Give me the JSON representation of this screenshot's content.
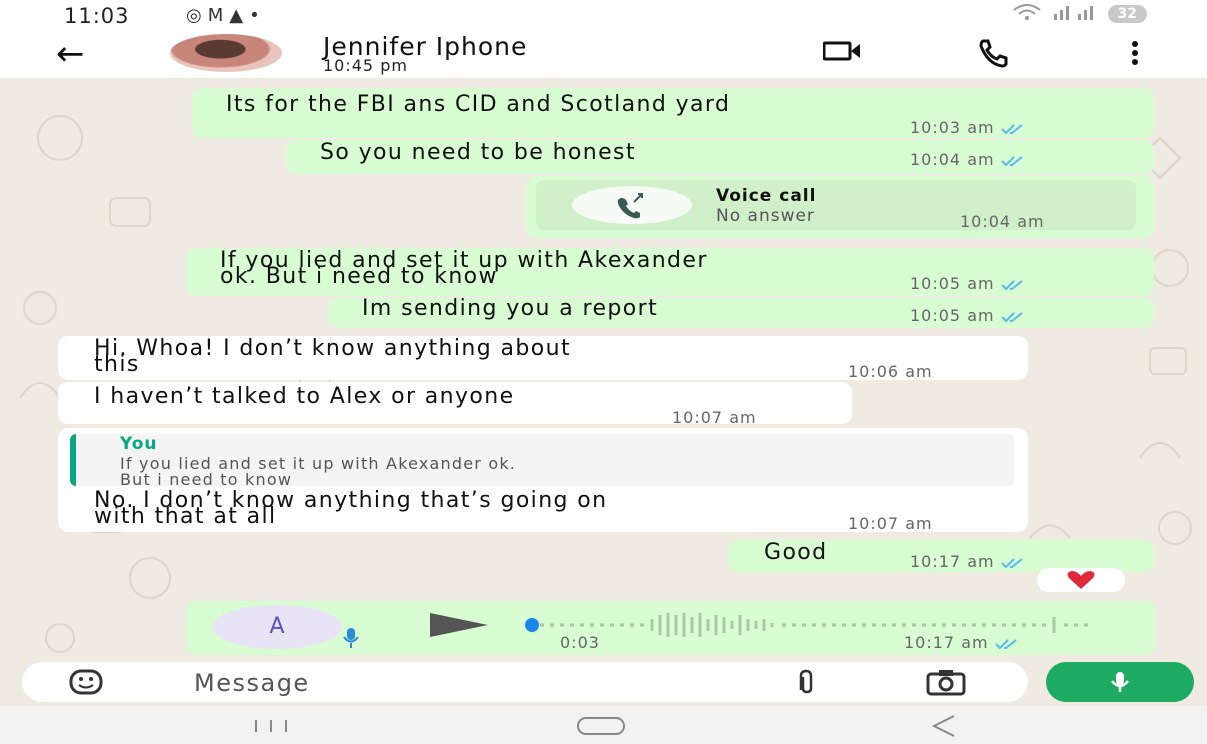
{
  "status_bar": {
    "time": "11:03",
    "left_icons": [
      "instagram-icon",
      "gmail-icon",
      "drive-icon"
    ],
    "battery": "32"
  },
  "header": {
    "contact_name": "Jennifer Iphone",
    "last_seen": "10:45 pm"
  },
  "messages": [
    {
      "dir": "out",
      "text": "Its for the FBI ans CID and Scotland yard",
      "time": "10:03 am",
      "read": true
    },
    {
      "dir": "out",
      "text": "So you need to be honest",
      "time": "10:04 am",
      "read": true
    },
    {
      "dir": "out",
      "type": "call",
      "title": "Voice call",
      "subtitle": "No answer",
      "time": "10:04 am"
    },
    {
      "dir": "out",
      "line1": "If you lied and set it up with Akexander",
      "line2": "ok. But i need to know",
      "time": "10:05 am",
      "read": true
    },
    {
      "dir": "out",
      "text": "Im sending you a report",
      "time": "10:05 am",
      "read": true
    },
    {
      "dir": "in",
      "line1": "Hi. Whoa! I don’t know anything about",
      "line2": "this",
      "time": "10:06 am"
    },
    {
      "dir": "in",
      "text": "I haven’t talked to Alex or anyone",
      "time": "10:07 am"
    },
    {
      "dir": "in",
      "quote_author": "You",
      "quote_line1": "If you lied and set it up with Akexander ok.",
      "quote_line2": "But i need to know",
      "line1": "No. I don’t know anything that’s going on",
      "line2": "with that at all",
      "time": "10:07 am"
    },
    {
      "dir": "out",
      "text": "Good",
      "time": "10:17 am",
      "read": true,
      "reaction": "red-heart"
    },
    {
      "dir": "out",
      "type": "voice",
      "avatar_letter": "A",
      "duration": "0:03",
      "time": "10:17 am",
      "read": true,
      "progress": 0
    }
  ],
  "input": {
    "placeholder": "Message"
  },
  "colors": {
    "outgoing_bubble": "#d9fdd3",
    "incoming_bubble": "#ffffff",
    "chat_background": "#efeae2",
    "read_ticks": "#53bdeb",
    "mic_button": "#1daa61",
    "quote_bar": "#06a884"
  }
}
